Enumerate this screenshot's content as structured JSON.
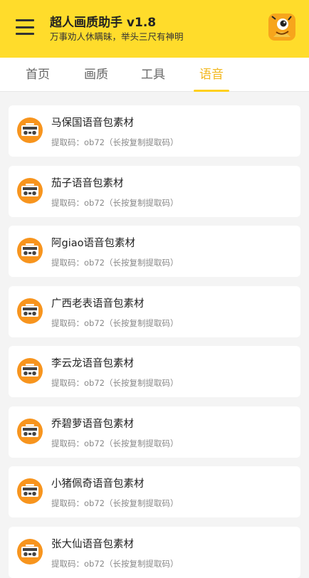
{
  "header": {
    "title": "超人画质助手 v1.8",
    "subtitle": "万事劝人休瞒昧，举头三尺有神明",
    "menu_icon": "hamburger-menu-icon",
    "logo_icon": "one-eyed-monster-logo"
  },
  "tabs": [
    {
      "label": "首页",
      "active": false
    },
    {
      "label": "画质",
      "active": false
    },
    {
      "label": "工具",
      "active": false
    },
    {
      "label": "语音",
      "active": true
    }
  ],
  "items": [
    {
      "title": "马保国语音包素材",
      "code": "提取码：ob72（长按复制提取码）"
    },
    {
      "title": "茄子语音包素材",
      "code": "提取码：ob72（长按复制提取码）"
    },
    {
      "title": "阿giao语音包素材",
      "code": "提取码：ob72（长按复制提取码）"
    },
    {
      "title": "广西老表语音包素材",
      "code": "提取码：ob72（长按复制提取码）"
    },
    {
      "title": "李云龙语音包素材",
      "code": "提取码：ob72（长按复制提取码）"
    },
    {
      "title": "乔碧萝语音包素材",
      "code": "提取码：ob72（长按复制提取码）"
    },
    {
      "title": "小猪佩奇语音包素材",
      "code": "提取码：ob72（长按复制提取码）"
    },
    {
      "title": "张大仙语音包素材",
      "code": "提取码：ob72（长按复制提取码）"
    }
  ],
  "item_icon": "radio-cassette-icon",
  "colors": {
    "accent": "#ffdc2b",
    "tab_active": "#f2b81f",
    "icon_orange": "#f7941d"
  }
}
